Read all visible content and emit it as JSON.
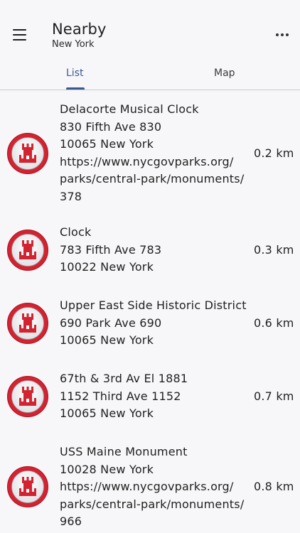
{
  "header": {
    "title": "Nearby",
    "subtitle": "New York"
  },
  "tabs": [
    {
      "label": "List",
      "selected": true
    },
    {
      "label": "Map",
      "selected": false
    }
  ],
  "colors": {
    "accent": "#3b5a8c",
    "icon_red": "#d32330"
  },
  "items": [
    {
      "icon": "monument-tower-icon",
      "lines": [
        "Delacorte Musical Clock",
        "830 Fifth Ave 830",
        "10065 New York",
        "https://www.nycgovparks.org/",
        "parks/central-park/monuments/",
        "378"
      ],
      "distance": "0.2 km"
    },
    {
      "icon": "monument-tower-icon",
      "lines": [
        "Clock",
        "783 Fifth Ave 783",
        "10022 New York"
      ],
      "distance": "0.3 km"
    },
    {
      "icon": "monument-tower-icon",
      "lines": [
        "Upper East Side Historic District",
        "690 Park Ave 690",
        "10065 New York"
      ],
      "distance": "0.6 km"
    },
    {
      "icon": "monument-tower-icon",
      "lines": [
        "67th & 3rd Av El 1881",
        "1152 Third Ave 1152",
        "10065 New York"
      ],
      "distance": "0.7 km"
    },
    {
      "icon": "monument-tower-icon",
      "lines": [
        "USS Maine Monument",
        "10028 New York",
        "https://www.nycgovparks.org/",
        "parks/central-park/monuments/",
        "966"
      ],
      "distance": "0.8 km"
    }
  ]
}
